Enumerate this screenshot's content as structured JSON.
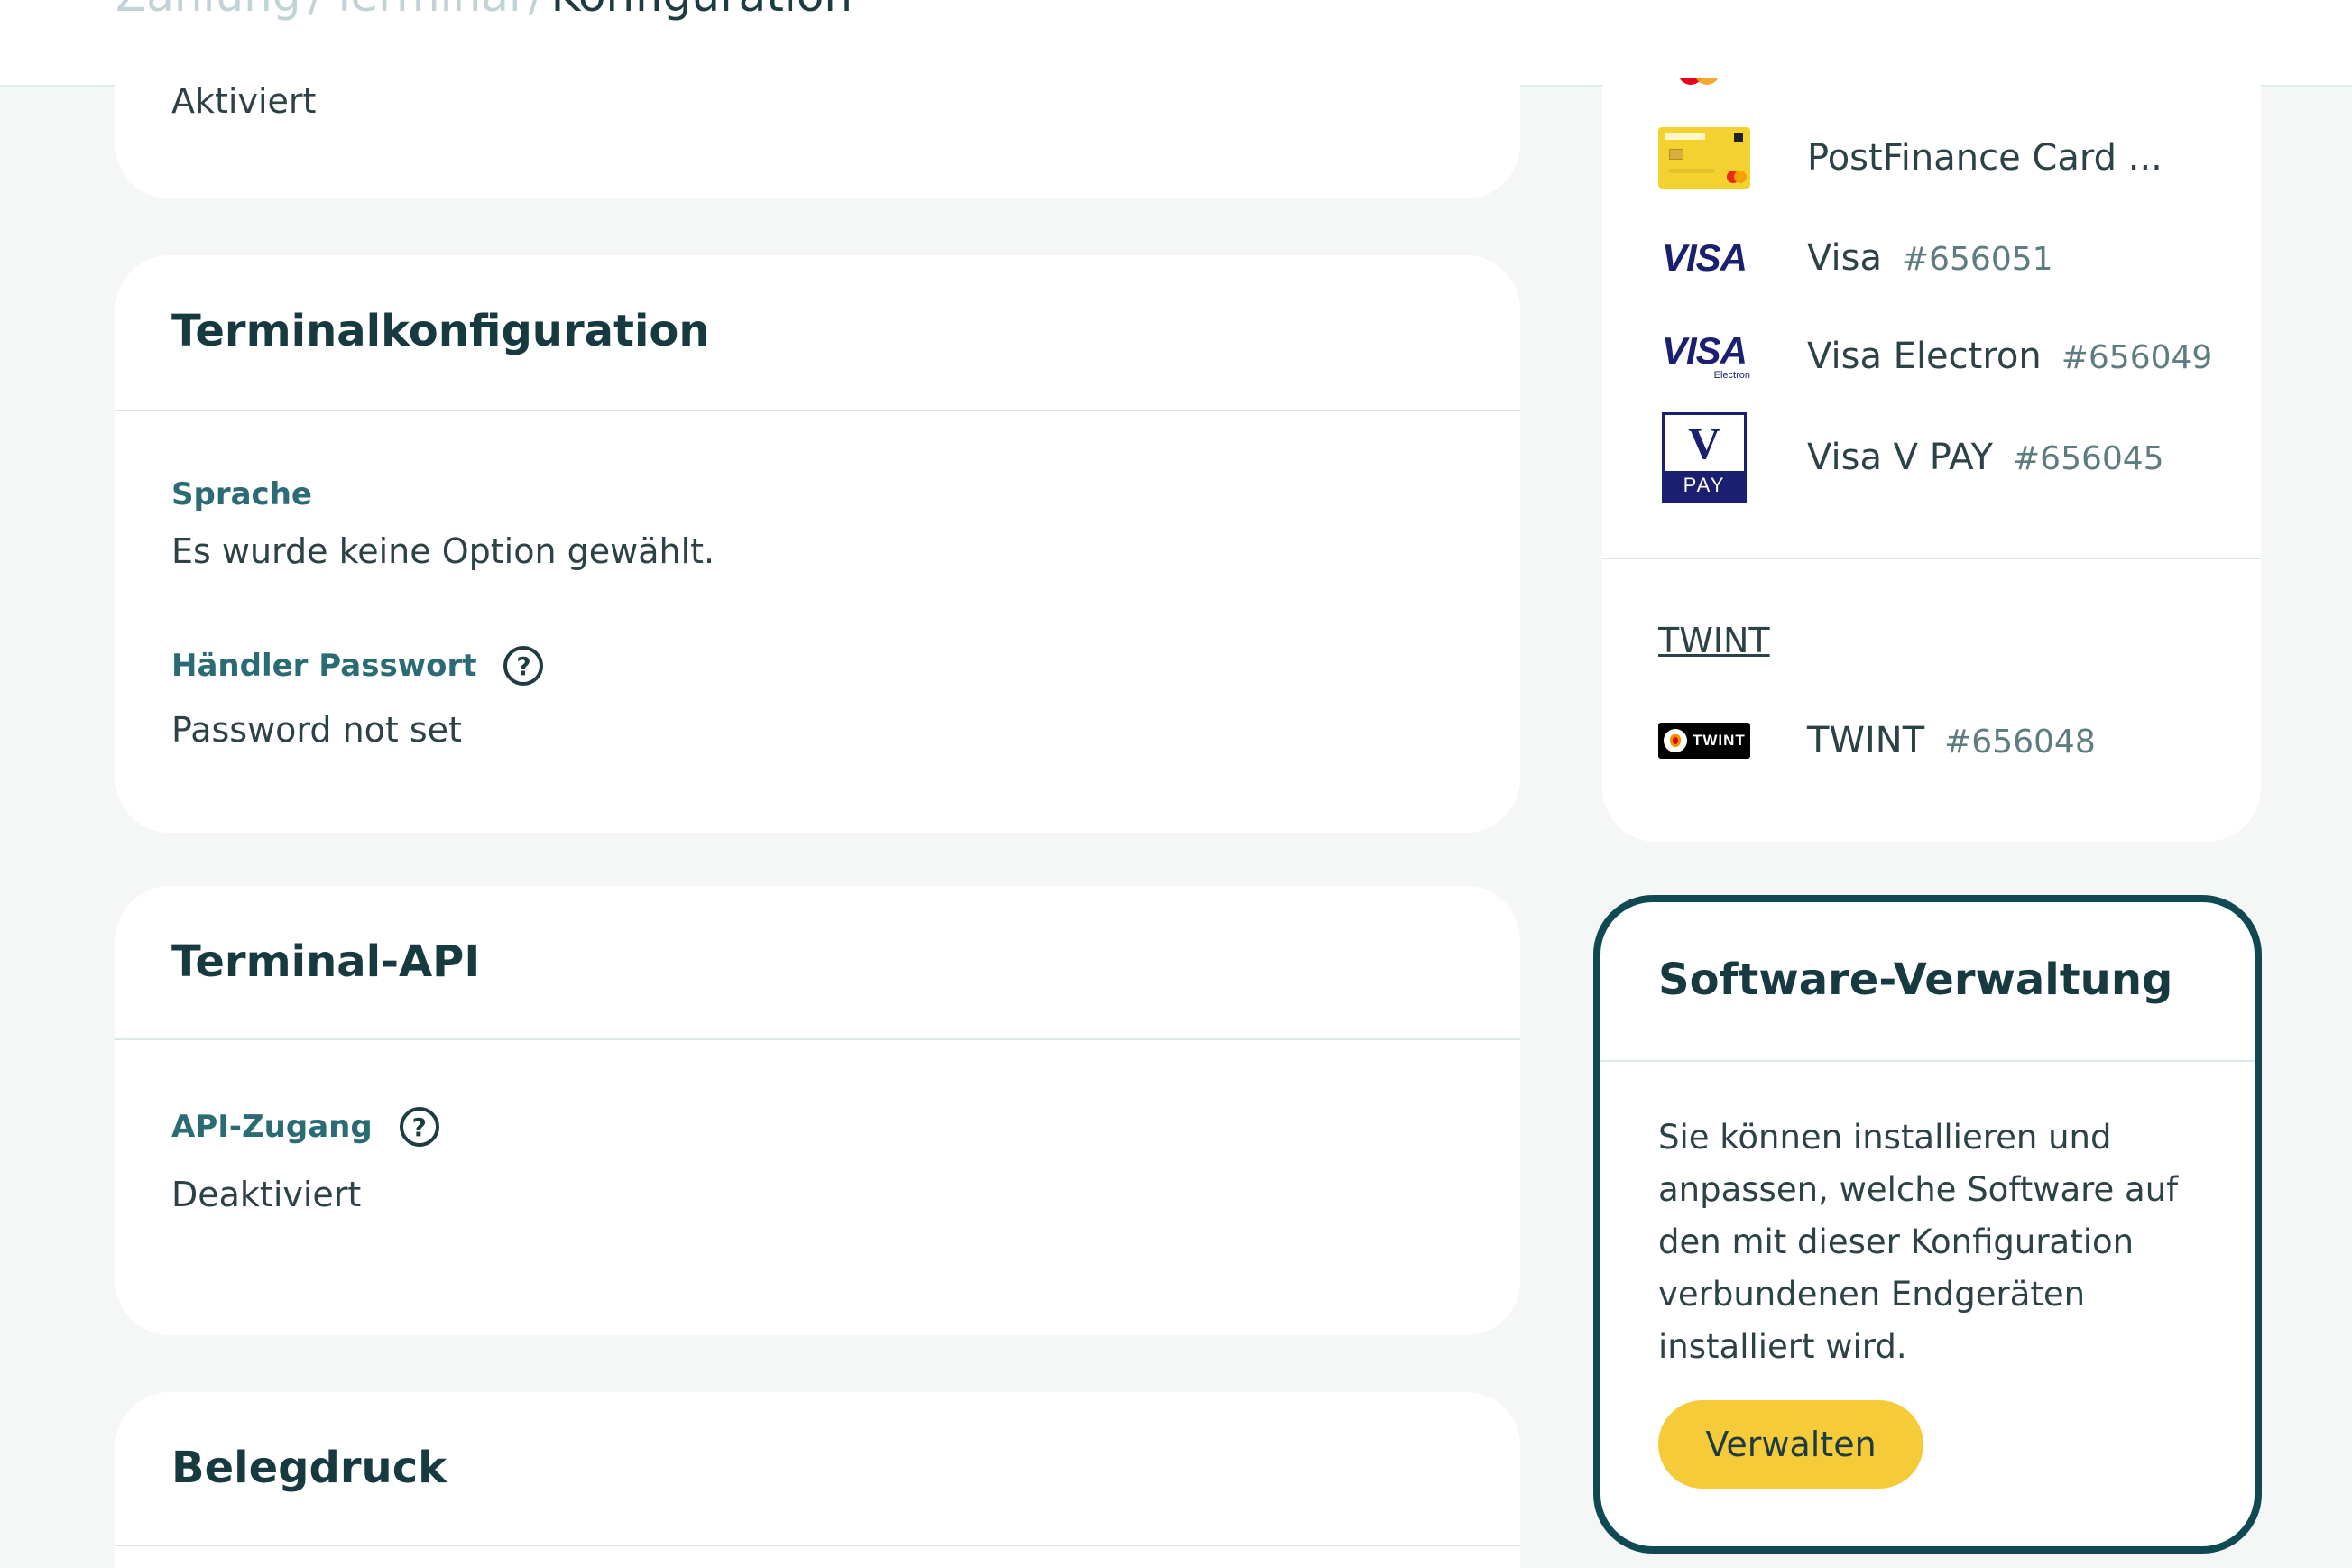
{
  "breadcrumb": {
    "items": [
      "Zahlung",
      "Terminal"
    ],
    "separator": "/",
    "current": "Konfiguration"
  },
  "status_card": {
    "value": "Aktiviert"
  },
  "terminal_config": {
    "title": "Terminalkonfiguration",
    "language_label": "Sprache",
    "language_value": "Es wurde keine Option gewählt.",
    "password_label": "Händler Passwort",
    "password_value": "Password not set"
  },
  "terminal_api": {
    "title": "Terminal-API",
    "api_access_label": "API-Zugang",
    "api_access_value": "Deaktiviert"
  },
  "receipt_print": {
    "title": "Belegdruck"
  },
  "payment_methods": {
    "items": [
      {
        "name": "PostFinance Card ...",
        "id": "",
        "icon": "postfinance-card-icon"
      },
      {
        "name": "Visa",
        "id": "#656051",
        "icon": "visa-icon"
      },
      {
        "name": "Visa Electron",
        "id": "#656049",
        "icon": "visa-electron-icon"
      },
      {
        "name": "Visa V PAY",
        "id": "#656045",
        "icon": "vpay-icon"
      }
    ],
    "twint_link": "TWINT",
    "twint_item": {
      "name": "TWINT",
      "id": "#656048",
      "icon": "twint-icon"
    }
  },
  "logos": {
    "visa": "VISA",
    "visa_electron_sub": "Electron",
    "vpay_top": "V",
    "vpay_bottom": "PAY",
    "twint": "TWINT"
  },
  "software_management": {
    "title": "Software-Verwaltung",
    "description": "Sie können installieren und anpassen, welche Software auf den mit dieser Konfiguration verbundenen Endgeräten installiert wird.",
    "button_label": "Verwalten"
  },
  "colors": {
    "accent": "#f6cb3a",
    "highlight_border": "#0f4a52",
    "label": "#2a6b74",
    "heading": "#163a40"
  }
}
